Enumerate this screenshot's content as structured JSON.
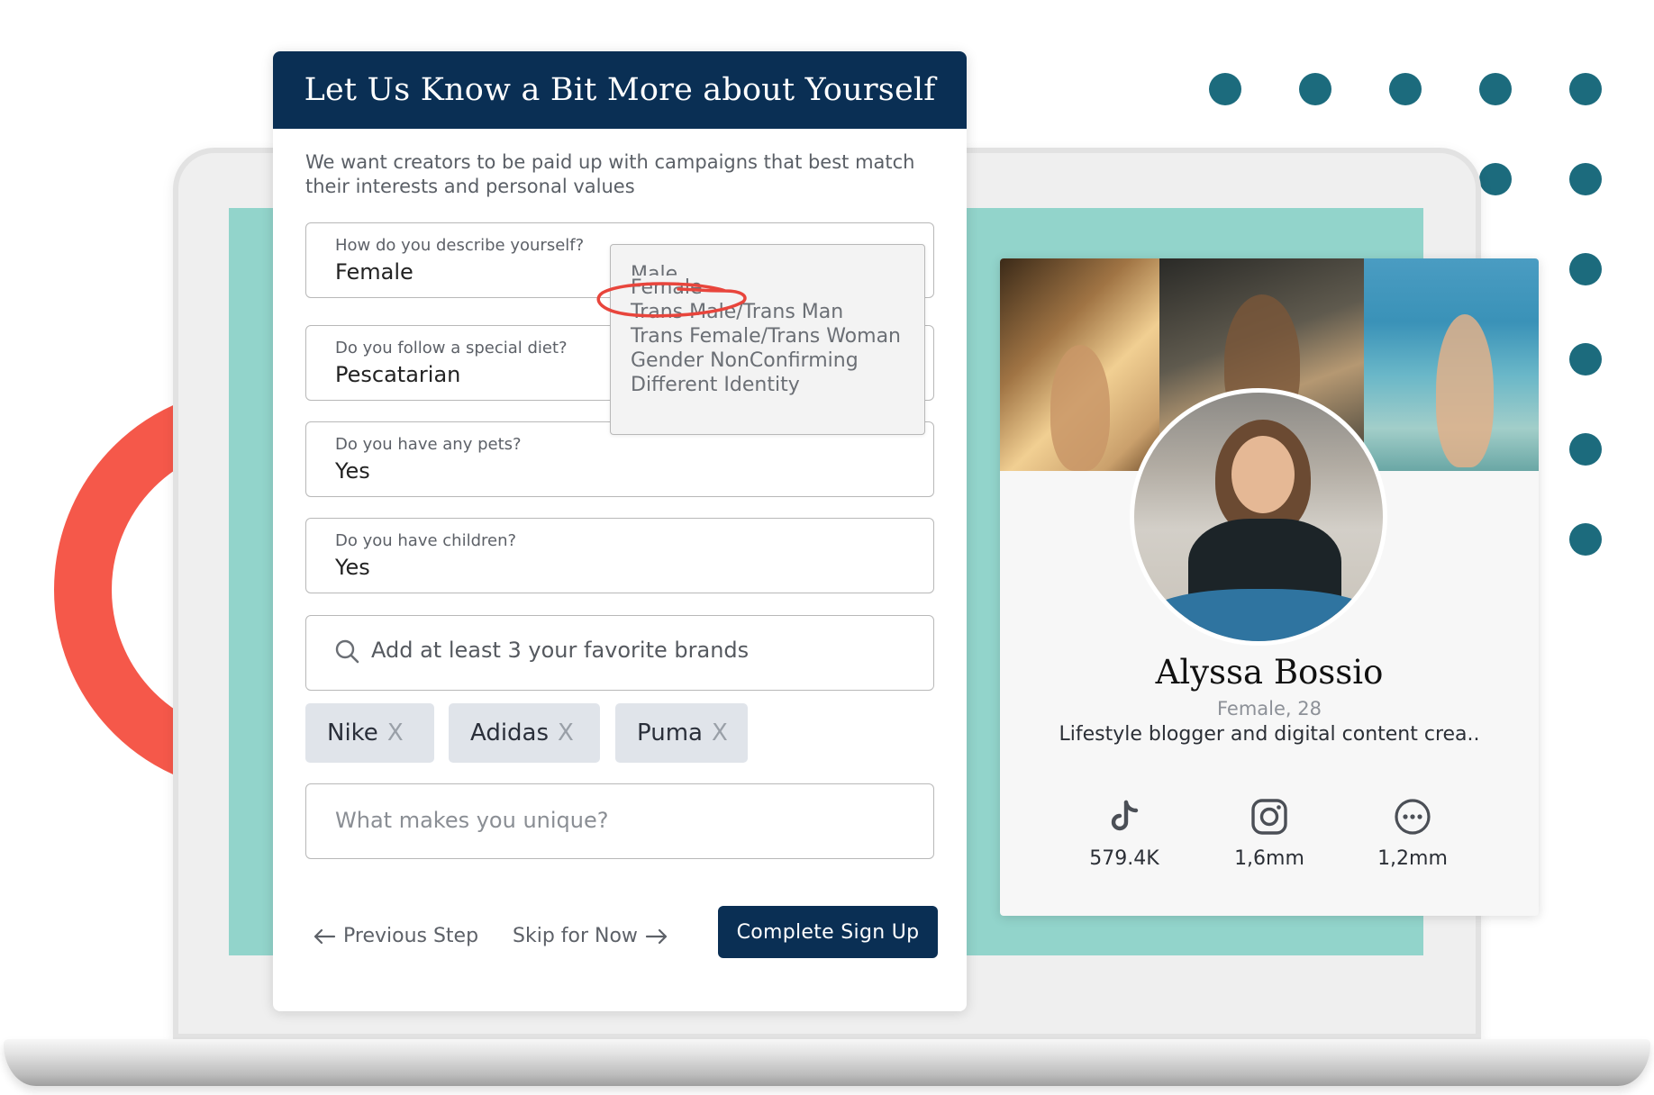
{
  "form": {
    "title": "Let Us Know a Bit More about Yourself",
    "intro": "We want creators to be paid up with campaigns that best match their interests and personal values",
    "fields": [
      {
        "label": "How do you describe yourself?",
        "value": "Female"
      },
      {
        "label": "Do you follow a special diet?",
        "value": "Pescatarian"
      },
      {
        "label": "Do you have any pets?",
        "value": "Yes"
      },
      {
        "label": "Do you have children?",
        "value": "Yes"
      }
    ],
    "brand_search_placeholder": "Add at least 3 your favorite brands",
    "brands": [
      {
        "name": "Nike",
        "remove": "X"
      },
      {
        "name": "Adidas",
        "remove": "X"
      },
      {
        "name": "Puma",
        "remove": "X"
      }
    ],
    "unique_placeholder": "What makes you unique?",
    "previous_label": "Previous Step",
    "skip_label": "Skip for Now",
    "complete_label": "Complete Sign Up"
  },
  "gender_dropdown": {
    "options": [
      "Male",
      "Female",
      "Trans Male/Trans Man",
      "Trans Female/Trans Woman",
      "Gender NonConfirming",
      "Different Identity"
    ],
    "selected": "Female"
  },
  "profile": {
    "name": "Alyssa Bossio",
    "meta": "Female, 28",
    "bio": "Lifestyle blogger and digital content crea..",
    "stats": [
      {
        "icon": "tiktok-icon",
        "value": "579.4K"
      },
      {
        "icon": "instagram-icon",
        "value": "1,6mm"
      },
      {
        "icon": "more-icon",
        "value": "1,2mm"
      }
    ]
  },
  "colors": {
    "navy": "#0a2f54",
    "teal_screen": "#92d4cb",
    "dot_teal": "#1c6b7d",
    "ring_coral": "#f5584a",
    "annotation_red": "#e8453c"
  }
}
